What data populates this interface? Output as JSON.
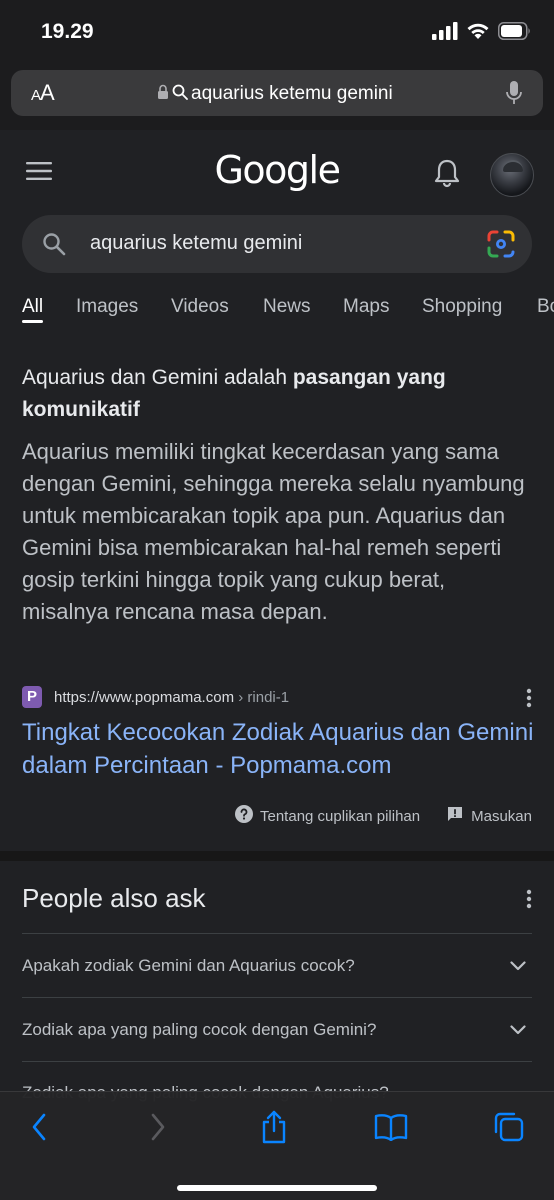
{
  "status_bar": {
    "time": "19.29"
  },
  "url_bar": {
    "aa_label_small": "A",
    "aa_label_large": "A",
    "url_text": "aquarius ketemu gemini"
  },
  "header": {
    "logo_text": "Google"
  },
  "search": {
    "query": "aquarius ketemu gemini"
  },
  "tabs": [
    {
      "label": "All",
      "active": true
    },
    {
      "label": "Images"
    },
    {
      "label": "Videos"
    },
    {
      "label": "News"
    },
    {
      "label": "Maps"
    },
    {
      "label": "Shopping"
    },
    {
      "label": "Bo"
    }
  ],
  "snippet": {
    "heading_plain": "Aquarius dan Gemini adalah ",
    "heading_bold": "pasangan yang komunikatif",
    "body": "Aquarius memiliki tingkat kecerdasan yang sama dengan Gemini, sehingga mereka selalu nyambung untuk membicarakan topik apa pun. Aquarius dan Gemini bisa membicarakan hal-hal remeh seperti gosip terkini hingga topik yang cukup berat, misalnya rencana masa depan.",
    "favicon_letter": "P",
    "source_url": "https://www.popmama.com",
    "source_crumb": " › rindi-1",
    "result_title": "Tingkat Kecocokan Zodiak Aquarius dan Gemini dalam Percintaan - Popmama.com",
    "about_label": "Tentang cuplikan pilihan",
    "feedback_label": "Masukan"
  },
  "people_also_ask": {
    "title": "People also ask",
    "questions": [
      "Apakah zodiak Gemini dan Aquarius cocok?",
      "Zodiak apa yang paling cocok dengan Gemini?"
    ],
    "partial_question": "Zodiak apa yang paling cocok dengan Aquarius?"
  },
  "colors": {
    "background": "#202124",
    "link": "#8ab4f8",
    "text": "#e8eaed",
    "ios_blue": "#0a84ff"
  }
}
